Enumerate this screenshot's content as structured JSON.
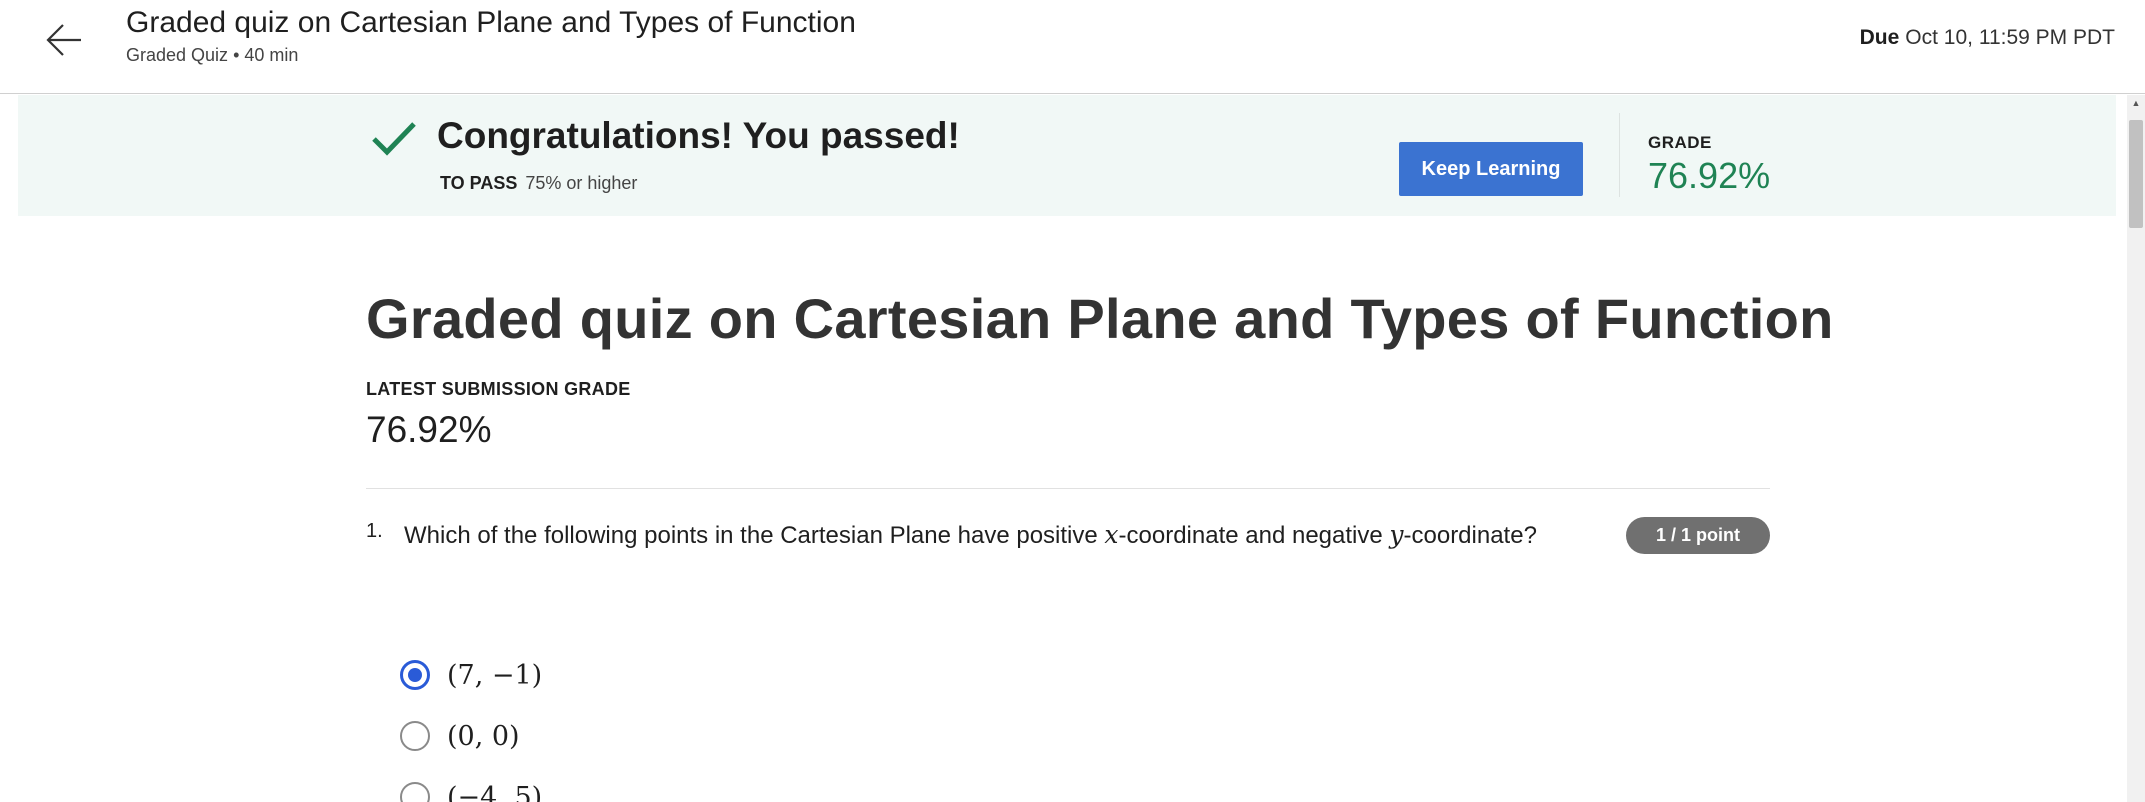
{
  "header": {
    "title": "Graded quiz on Cartesian Plane and Types of Function",
    "subtitle_type": "Graded Quiz",
    "subtitle_separator": "•",
    "subtitle_duration": "40 min",
    "due_label": "Due",
    "due_value": "Oct 10, 11:59 PM PDT"
  },
  "banner": {
    "title": "Congratulations! You passed!",
    "to_pass_label": "TO PASS",
    "to_pass_value": "75% or higher",
    "keep_learning_label": "Keep Learning",
    "grade_label": "GRADE",
    "grade_value": "76.92%",
    "success_color": "#1f8354",
    "button_color": "#3b73d1"
  },
  "main": {
    "title": "Graded quiz on Cartesian Plane and Types of Function",
    "latest_submission_label": "LATEST SUBMISSION GRADE",
    "latest_submission_value": "76.92%"
  },
  "question": {
    "number": "1.",
    "text_part1": "Which of the following points in the Cartesian Plane have positive ",
    "var_x": "x",
    "text_part2": "-coordinate and negative ",
    "var_y": "y",
    "text_part3": "-coordinate?",
    "points": "1 / 1 point",
    "options": [
      {
        "label": "(7, −1)",
        "selected": true
      },
      {
        "label": "(0, 0)",
        "selected": false
      },
      {
        "label": "(−4, 5)",
        "selected": false
      }
    ]
  },
  "icons": {
    "back": "arrow-left-icon",
    "check": "checkmark-icon",
    "scroll_up": "triangle-up-icon"
  }
}
